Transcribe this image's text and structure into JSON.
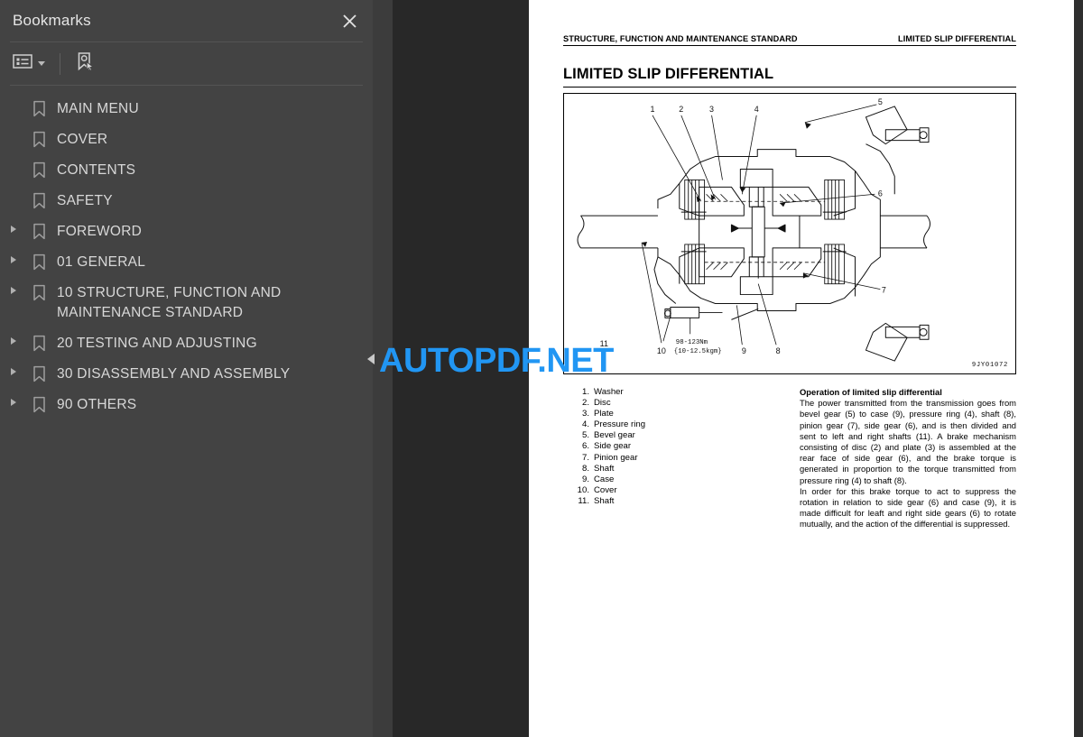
{
  "sidebar": {
    "title": "Bookmarks",
    "close_icon": "close-icon",
    "toolbar": {
      "list_options_icon": "list-options-icon",
      "expand_current_bookmark_icon": "bookmark-cursor-icon"
    },
    "items": [
      {
        "label": "MAIN MENU",
        "expandable": false
      },
      {
        "label": "COVER",
        "expandable": false
      },
      {
        "label": "CONTENTS",
        "expandable": false
      },
      {
        "label": "SAFETY",
        "expandable": false
      },
      {
        "label": "FOREWORD",
        "expandable": true
      },
      {
        "label": "01 GENERAL",
        "expandable": true
      },
      {
        "label": "10 STRUCTURE, FUNCTION AND MAINTENANCE STANDARD",
        "expandable": true
      },
      {
        "label": "20 TESTING AND ADJUSTING",
        "expandable": true
      },
      {
        "label": "30 DISASSEMBLY AND ASSEMBLY",
        "expandable": true
      },
      {
        "label": "90 OTHERS",
        "expandable": true
      }
    ]
  },
  "collapse_handle_icon": "collapse-sidebar-icon",
  "watermark": {
    "text": "AUTOPDF.NET",
    "color": "#2196f3"
  },
  "document": {
    "running_head_left": "STRUCTURE, FUNCTION AND MAINTENANCE STANDARD",
    "running_head_right": "LIMITED SLIP DIFFERENTIAL",
    "title": "LIMITED SLIP DIFFERENTIAL",
    "figure": {
      "drawing_code": "9JY01072",
      "torque_note_line1": "98-123Nm",
      "torque_note_line2": "{10-12.5kgm}",
      "callouts": [
        "1",
        "2",
        "3",
        "4",
        "5",
        "6",
        "7",
        "8",
        "9",
        "10",
        "11"
      ]
    },
    "parts": [
      {
        "num": "1.",
        "name": "Washer"
      },
      {
        "num": "2.",
        "name": "Disc"
      },
      {
        "num": "3.",
        "name": "Plate"
      },
      {
        "num": "4.",
        "name": "Pressure ring"
      },
      {
        "num": "5.",
        "name": "Bevel gear"
      },
      {
        "num": "6.",
        "name": "Side gear"
      },
      {
        "num": "7.",
        "name": "Pinion gear"
      },
      {
        "num": "8.",
        "name": "Shaft"
      },
      {
        "num": "9.",
        "name": "Case"
      },
      {
        "num": "10.",
        "name": "Cover"
      },
      {
        "num": "11.",
        "name": "Shaft"
      }
    ],
    "operation": {
      "heading": "Operation of limited slip differential",
      "paragraph1": "The power transmitted from the transmission goes from bevel gear (5) to case (9), pressure ring (4), shaft (8), pinion gear (7), side gear (6), and is then divided and sent to left and right shafts (11). A brake mechanism consisting of disc (2) and plate (3) is assembled at the rear face of side gear (6), and the brake torque is generated in proportion to the torque transmitted from pressure ring (4) to shaft (8).",
      "paragraph2": "In order for this brake torque to act to suppress the rotation in relation to side gear (6) and case (9), it is made difficult for leaft and right side gears (6) to rotate mutually, and the action of the differential is suppressed."
    }
  }
}
